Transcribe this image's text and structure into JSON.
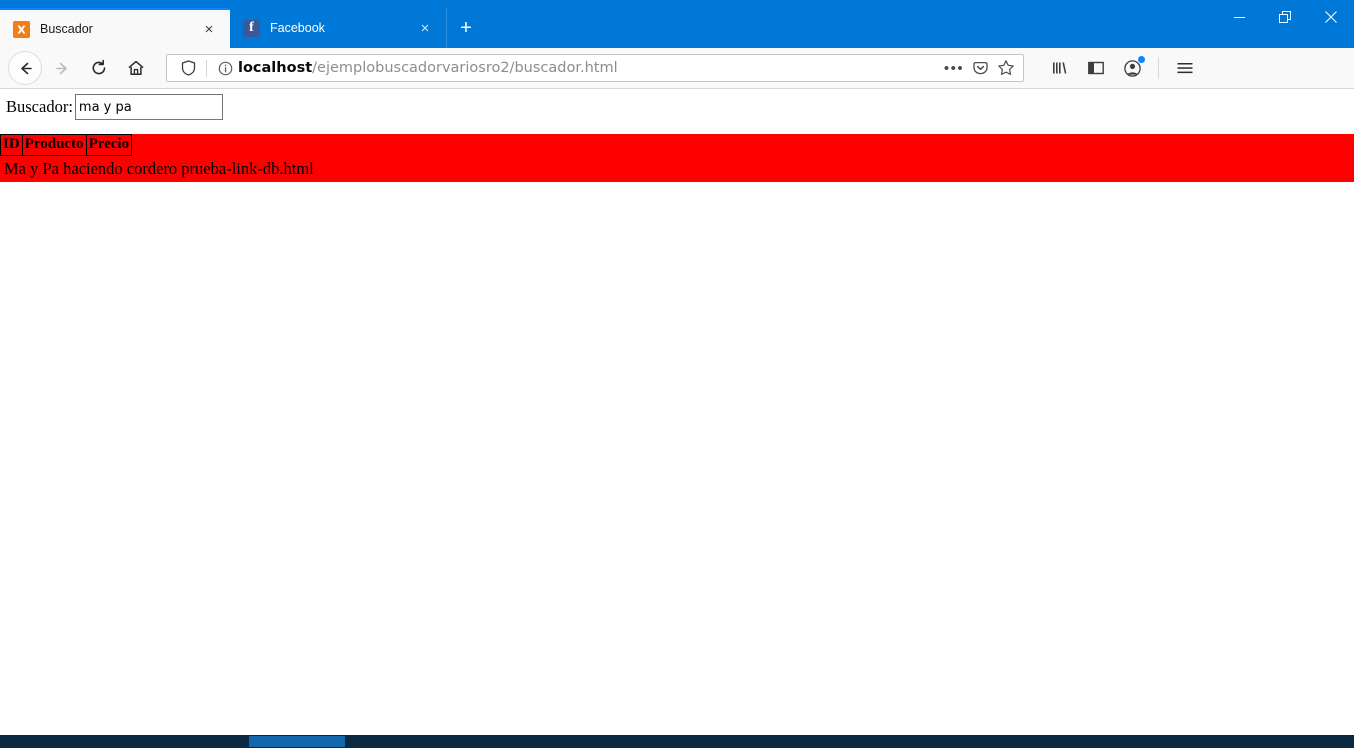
{
  "window": {
    "controls": {
      "minimize_label": "Minimize",
      "restore_label": "Restore",
      "close_label": "Close"
    }
  },
  "tabs": [
    {
      "title": "Buscador",
      "favicon": "xampp-icon",
      "favicon_glyph": "⌘",
      "active": true,
      "close_label": "×"
    },
    {
      "title": "Facebook",
      "favicon": "facebook-icon",
      "favicon_glyph": "f",
      "active": false,
      "close_label": "×"
    }
  ],
  "new_tab": {
    "label": "+",
    "tooltip": "Open a new tab"
  },
  "toolbar": {
    "back_label": "Back",
    "forward_label": "Forward",
    "reload_label": "Reload",
    "home_label": "Home",
    "page_actions_label": "•••",
    "pocket_label": "Save to Pocket",
    "bookmark_label": "Bookmark this page",
    "library_label": "Library",
    "sidebar_label": "Sidebars",
    "account_label": "Account",
    "menu_label": "Open menu"
  },
  "urlbar": {
    "shield_label": "Tracking protection",
    "info_label": "Site information",
    "host": "localhost",
    "path": "/ejemplobuscadorvariosro2/buscador.html",
    "full_url": "localhost/ejemplobuscadorvariosro2/buscador.html"
  },
  "page": {
    "search": {
      "label": "Buscador:",
      "value": "ma y pa",
      "placeholder": ""
    },
    "results": {
      "background_color": "#ff0000",
      "columns": [
        "ID",
        "Producto",
        "Precio"
      ],
      "rows": [
        {
          "text": "Ma y Pa haciendo cordero prueba-link-db.html"
        }
      ]
    }
  },
  "taskbar": {
    "background_color": "#0b2a42",
    "active_item_color": "#1267ad"
  }
}
